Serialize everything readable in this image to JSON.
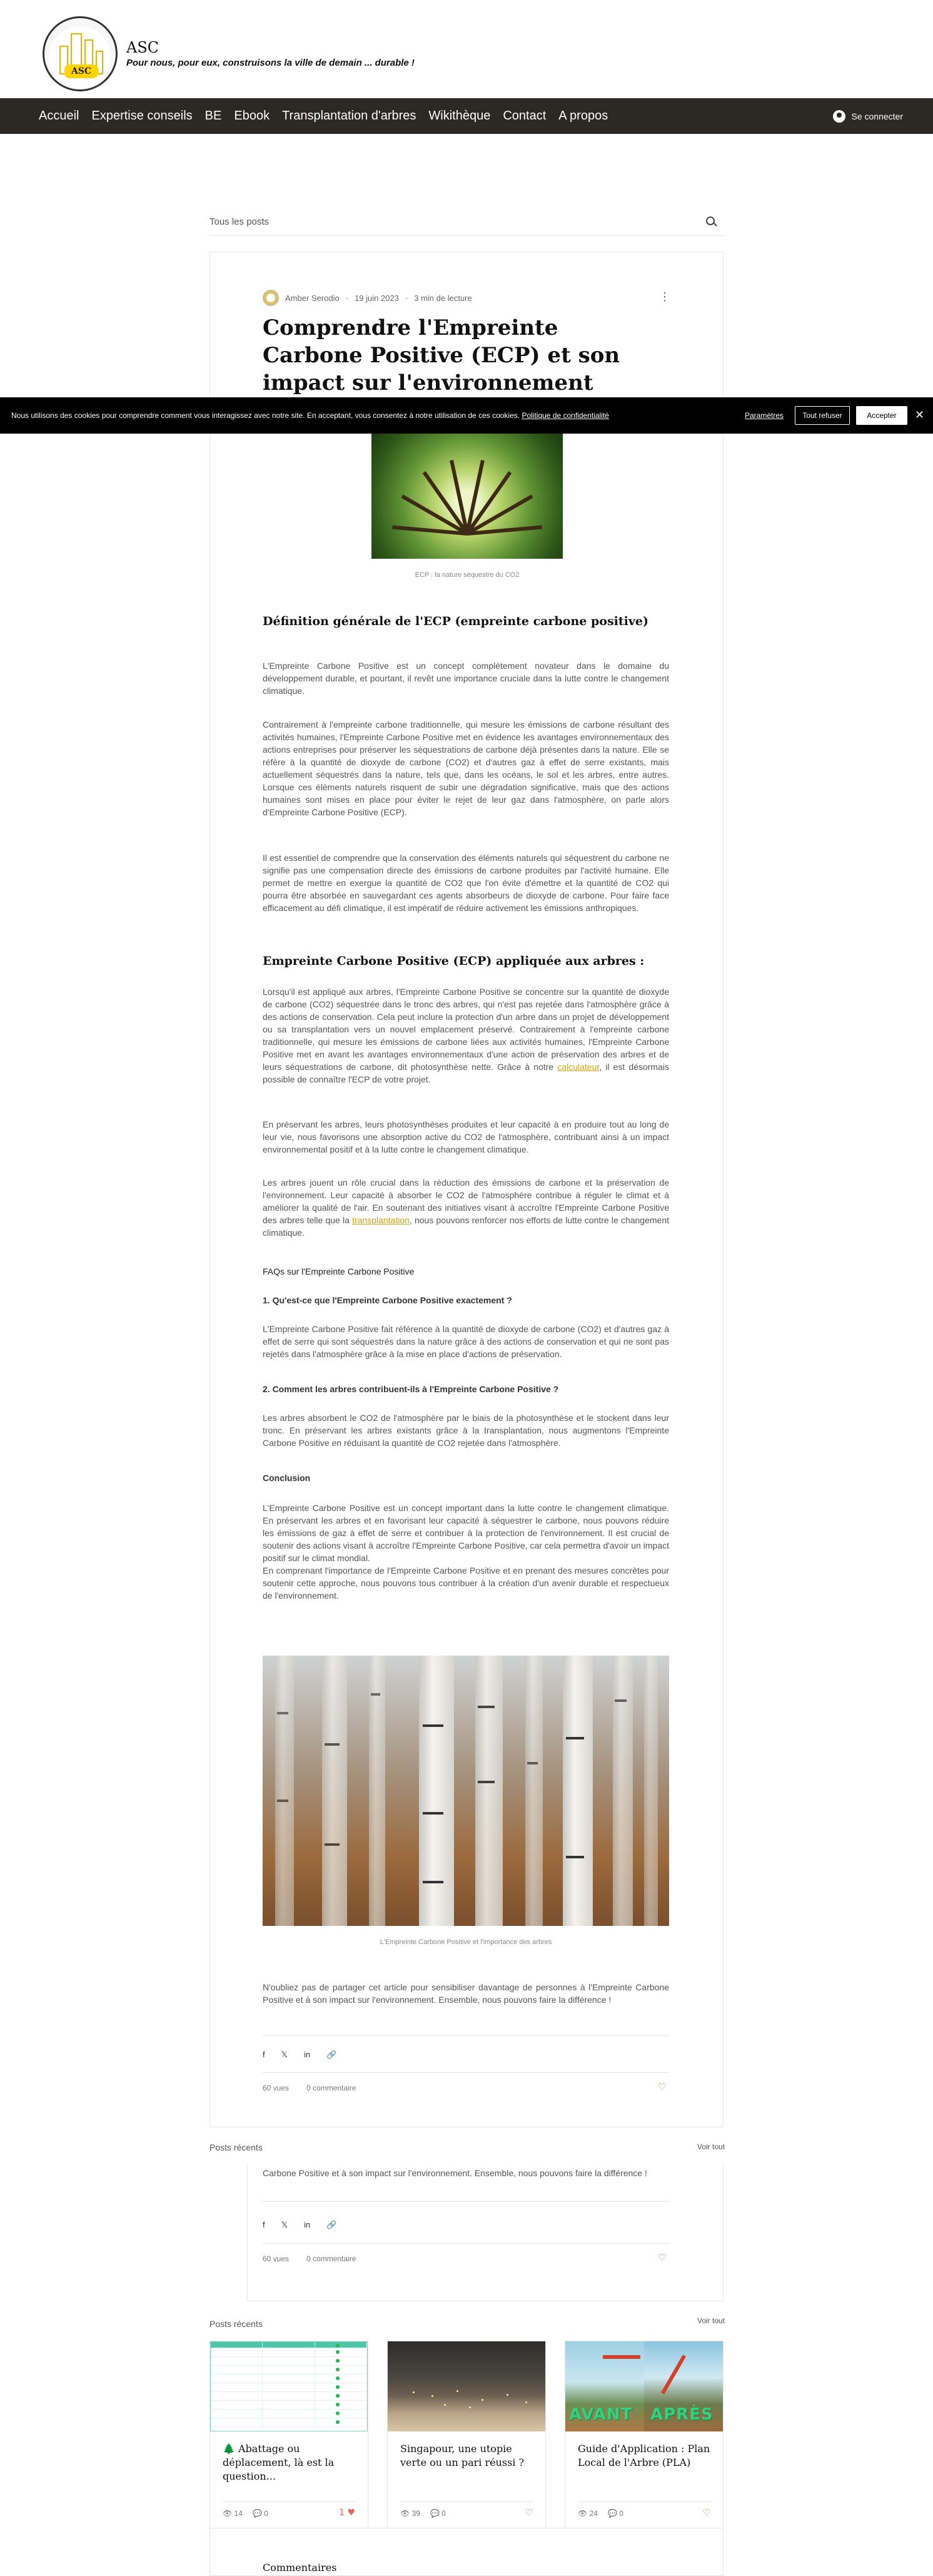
{
  "header": {
    "logo_text": "ASC",
    "brand": "ASC",
    "tagline": "Pour nous, pour eux, construisons la ville de demain ... durable !"
  },
  "nav": {
    "items": [
      "Accueil",
      "Expertise conseils",
      "BE",
      "Ebook",
      "Transplantation d'arbres",
      "Wikithèque",
      "Contact",
      "A propos"
    ],
    "login_label": "Se connecter"
  },
  "blog": {
    "all_posts_label": "Tous les posts"
  },
  "article": {
    "author": "Amber Serodio",
    "date": "19 juin 2023",
    "read_time": "3 min de lecture",
    "more_icon": "⋮",
    "title": "Comprendre l'Empreinte Carbone Positive (ECP) et son impact sur l'environnement",
    "hero_caption": "ECP : la nature séquestre du CO2",
    "section1_title": "Définition générale de l'ECP (empreinte carbone positive)",
    "p1": "L'Empreinte Carbone Positive est un concept complètement novateur dans le domaine du développement durable, et pourtant, il revêt une importance cruciale dans la lutte contre le changement climatique.",
    "p2": "Contrairement à l'empreinte carbone traditionnelle, qui mesure les émissions de carbone résultant des activités humaines, l'Empreinte Carbone Positive met en évidence les avantages environnementaux des actions entreprises pour préserver les séquestrations de carbone déjà présentes dans la nature. Elle se réfère à la quantité de dioxyde de carbone (CO2) et d'autres gaz à effet de serre existants, mais actuellement séquestrés dans la nature, tels que, dans les océans, le sol et les arbres, entre autres. Lorsque ces éléments naturels risquent de subir une dégradation significative, mais que des actions humaines sont mises en place pour éviter le rejet de leur gaz dans l'atmosphère, on parle alors d'Empreinte Carbone Positive (ECP).",
    "p3": "Il est essentiel de comprendre que la conservation des éléments naturels qui séquestrent du carbone ne signifie pas une compensation directe des émissions de carbone produites par l'activité humaine. Elle permet de mettre en exergue la quantité de CO2 que l'on évite d'émettre et la quantité de CO2 qui pourra être absorbée en sauvegardant ces agents absorbeurs de dioxyde de carbone. Pour faire face efficacement au défi climatique, il est impératif de réduire activement les émissions anthropiques.",
    "section2_title": "Empreinte Carbone Positive (ECP) appliquée aux arbres :",
    "p4_before": "Lorsqu'il est appliqué aux arbres, l'Empreinte Carbone Positive se concentre sur la quantité de dioxyde de carbone (CO2) séquestrée dans le tronc des arbres, qui n'est pas rejetée dans l'atmosphère grâce à des actions de conservation. Cela peut inclure la protection d'un arbre dans un projet de développement ou sa transplantation vers un nouvel emplacement préservé. Contrairement à l'empreinte carbone traditionnelle, qui mesure les émissions de carbone liées aux activités humaines, l'Empreinte Carbone Positive met en avant les avantages environnementaux d'une action de préservation des arbres et de leurs séquestrations de carbone, dit photosynthèse nette. Grâce à notre ",
    "p4_link": "calculateur",
    "p4_after": ", il est désormais possible de connaître l'ECP de votre projet.",
    "p5": "En préservant les arbres, leurs photosynthèses produites et leur capacité à en produire tout au long de leur vie, nous favorisons une absorption active du CO2 de l'atmosphère, contribuant ainsi à un impact environnemental positif et à la lutte contre le changement climatique.",
    "p6_before": "Les arbres jouent un rôle crucial dans la réduction des émissions de carbone et la préservation de l'environnement. Leur capacité à absorber le CO2 de l'atmosphère contribue à réguler le climat et à améliorer la qualité de l'air. En soutenant des initiatives visant à accroître l'Empreinte Carbone Positive des arbres telle que la ",
    "p6_link": "transplantation",
    "p6_after": ", nous pouvons renforcer nos efforts de lutte contre le changement climatique.",
    "faq_title": "FAQs sur l'Empreinte Carbone Positive",
    "q1": "1. Qu'est-ce que l'Empreinte Carbone Positive exactement ?",
    "a1": "L'Empreinte Carbone Positive fait référence à la quantité de dioxyde de carbone (CO2) et d'autres gaz à effet de serre qui sont séquestrés dans la nature grâce à des actions de conservation et qui ne sont pas rejetés dans l'atmosphère grâce à la mise en place d'actions de préservation.",
    "q2": "2. Comment les arbres contribuent-ils à l'Empreinte Carbone Positive ?",
    "a2": "Les arbres absorbent le CO2 de l'atmosphère par le biais de la photosynthèse et le stockent dans leur tronc. En préservant les arbres existants grâce à la transplantation, nous augmentons l'Empreinte Carbone Positive en réduisant la quantité de CO2 rejetée dans l'atmosphère.",
    "conclusion_title": "Conclusion",
    "c1": "L'Empreinte Carbone Positive est un concept important dans la lutte contre le changement climatique. En préservant les arbres et en favorisant leur capacité à séquestrer le carbone, nous pouvons réduire les émissions de gaz à effet de serre et contribuer à la protection de l'environnement. Il est crucial de soutenir des actions visant à accroître l'Empreinte Carbone Positive, car cela permettra d'avoir un impact positif sur le climat mondial.",
    "c2": "En comprenant l'importance de l'Empreinte Carbone Positive et en prenant des mesures concrètes pour soutenir cette approche, nous pouvons tous contribuer à la création d'un avenir durable et respectueux de l'environnement.",
    "birch_caption": "L'Empreinte Carbone Positive et l'importance des arbres",
    "closing": "N'oubliez pas de partager cet article pour sensibiliser davantage de personnes à l'Empreinte Carbone Positive et à son impact sur l'environnement. Ensemble, nous pouvons faire la différence !",
    "closing_dup": "Carbone Positive et à son impact sur l'environnement. Ensemble, nous pouvons faire la différence !",
    "share": {
      "facebook": "f",
      "x": "𝕏",
      "linkedin": "in",
      "link": "🔗"
    },
    "views": "60 vues",
    "comments": "0 commentaire",
    "heart": "♡"
  },
  "cookie": {
    "text": "Nous utilisons des cookies pour comprendre comment vous interagissez avec notre site. En acceptant, vous consentez à notre utilisation de ces cookies.",
    "policy_link": "Politique de confidentialité",
    "settings": "Paramètres",
    "refuse": "Tout refuser",
    "accept": "Accepter",
    "close": "✕"
  },
  "recent": {
    "label": "Posts récents",
    "see_all": "Voir tout",
    "posts": [
      {
        "title": "🌲 Abattage ou déplacement, là est la question...",
        "views": "14",
        "comments": "0",
        "likes": "1",
        "heart": "♥"
      },
      {
        "title": "Singapour, une utopie verte ou un pari réussi ?",
        "views": "39",
        "comments": "0",
        "likes": "",
        "heart": "♡"
      },
      {
        "title": "Guide d'Application : Plan Local de l'Arbre (PLA)",
        "views": "24",
        "comments": "0",
        "likes": "",
        "heart": "♡"
      }
    ],
    "thumb3_words": [
      "AVANT",
      "APRÈS"
    ]
  },
  "comments_section": {
    "label": "Commentaires"
  },
  "colors": {
    "nav_bg": "#2c2924",
    "accent_link": "#d4a017",
    "heart": "#e9655a",
    "logo_yellow": "#ffd400"
  }
}
